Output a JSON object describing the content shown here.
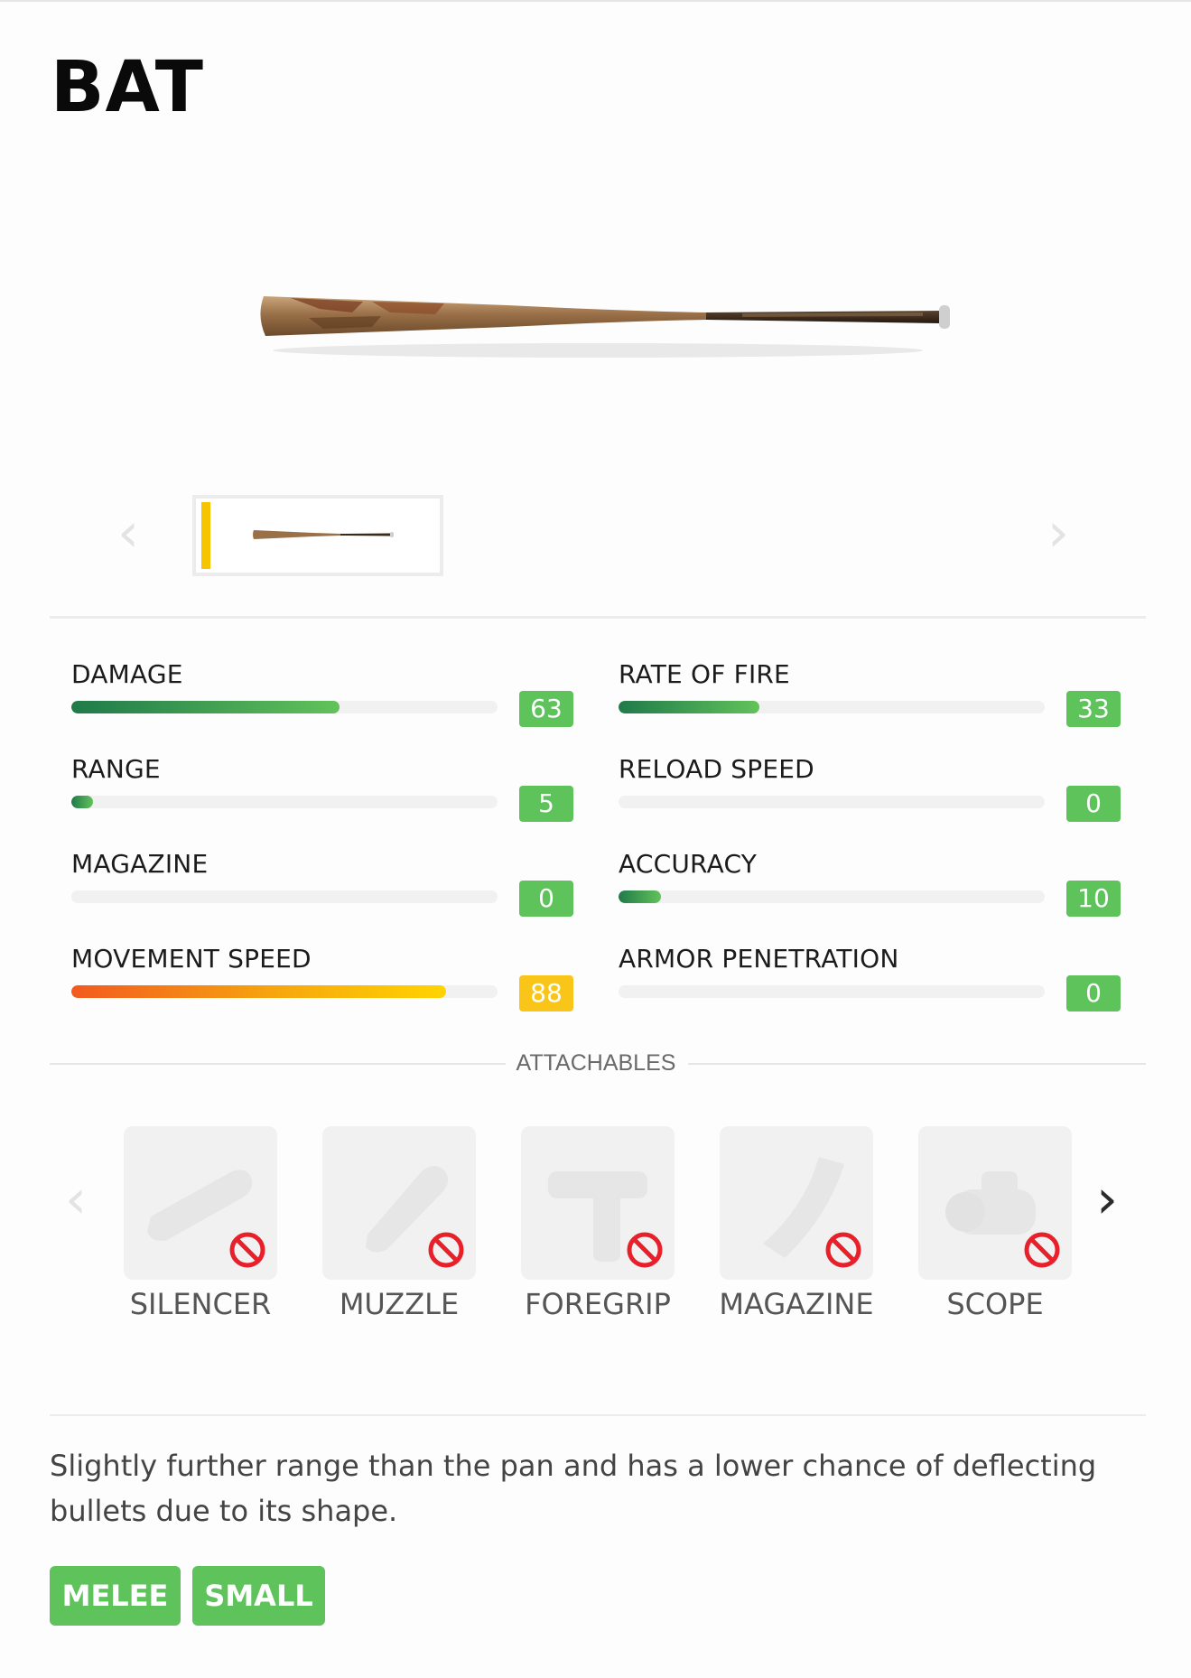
{
  "weapon": {
    "name": "BAT",
    "image_icon": "baseball-bat-image"
  },
  "gallery": {
    "prev_icon": "chevron-left-icon",
    "next_icon": "chevron-right-icon",
    "thumbnail_icon": "baseball-bat-thumbnail",
    "selected_color": "#f7c400"
  },
  "stats": [
    {
      "label": "DAMAGE",
      "value": "63",
      "percent": 63,
      "style": "green"
    },
    {
      "label": "RATE OF FIRE",
      "value": "33",
      "percent": 33,
      "style": "green"
    },
    {
      "label": "RANGE",
      "value": "5",
      "percent": 5,
      "style": "green"
    },
    {
      "label": "RELOAD SPEED",
      "value": "0",
      "percent": 0,
      "style": "green"
    },
    {
      "label": "MAGAZINE",
      "value": "0",
      "percent": 0,
      "style": "green"
    },
    {
      "label": "ACCURACY",
      "value": "10",
      "percent": 10,
      "style": "green"
    },
    {
      "label": "MOVEMENT SPEED",
      "value": "88",
      "percent": 88,
      "style": "orange"
    },
    {
      "label": "ARMOR PENETRATION",
      "value": "0",
      "percent": 0,
      "style": "green"
    }
  ],
  "attachables": {
    "title": "ATTACHABLES",
    "prev_icon": "chevron-left-icon",
    "next_icon": "chevron-right-icon",
    "items": [
      {
        "label": "SILENCER",
        "icon": "silencer-icon",
        "status_icon": "not-allowed-icon"
      },
      {
        "label": "MUZZLE",
        "icon": "muzzle-icon",
        "status_icon": "not-allowed-icon"
      },
      {
        "label": "FOREGRIP",
        "icon": "foregrip-icon",
        "status_icon": "not-allowed-icon"
      },
      {
        "label": "MAGAZINE",
        "icon": "magazine-icon",
        "status_icon": "not-allowed-icon"
      },
      {
        "label": "SCOPE",
        "icon": "scope-icon",
        "status_icon": "not-allowed-icon"
      }
    ]
  },
  "description": "Slightly further range than the pan and has a lower chance of deflecting bullets due to its shape.",
  "tags": [
    "MELEE",
    "SMALL"
  ],
  "colors": {
    "badge_green": "#5dc35a",
    "badge_yellow": "#f9c519",
    "ban_red": "#e8202a"
  }
}
